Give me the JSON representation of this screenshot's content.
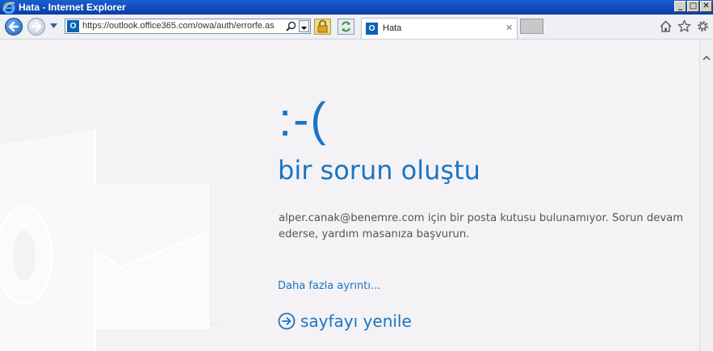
{
  "window": {
    "title": "Hata - Internet Explorer",
    "controls": [
      "_",
      "□",
      "✕"
    ]
  },
  "toolbar": {
    "address": "https://outlook.office365.com/owa/auth/errorfe.as",
    "tab_title": "Hata",
    "tab_close": "✕"
  },
  "error": {
    "face": ":-(",
    "heading": "bir sorun oluştu",
    "message": "alper.canak@benemre.com için bir posta kutusu bulunamıyor. Sorun devam ederse, yardım masanıza başvurun.",
    "more_details": "Daha fazla ayrıntı...",
    "refresh": "sayfayı yenile"
  },
  "colors": {
    "accent": "#1b75c2",
    "background": "#f4f2f5",
    "titlebar": "#0a3ea6"
  },
  "icons": {
    "back": "back-arrow-icon",
    "forward": "forward-arrow-icon",
    "search": "search-icon",
    "lock": "lock-icon",
    "refresh": "refresh-icon",
    "home": "home-icon",
    "favorites": "star-icon",
    "tools": "gear-icon",
    "background": "outlook-logo-icon"
  }
}
